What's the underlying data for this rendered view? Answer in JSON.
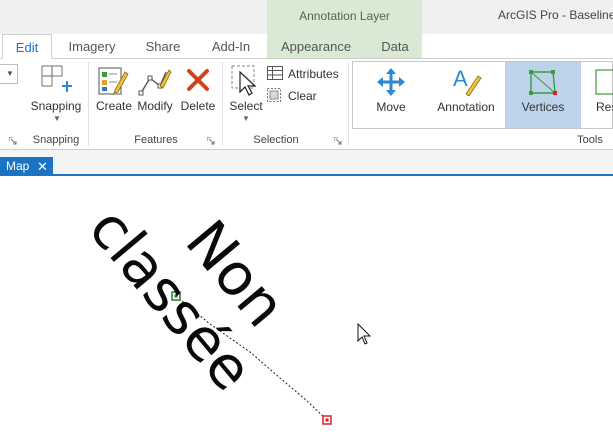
{
  "app": {
    "title": "ArcGIS Pro - BaselineA"
  },
  "context_tab_group": {
    "label": "Annotation Layer",
    "color": "#d9e9d3"
  },
  "tabs": [
    {
      "label": "Edit",
      "active": true
    },
    {
      "label": "Imagery"
    },
    {
      "label": "Share"
    },
    {
      "label": "Add-In"
    },
    {
      "label": "Appearance"
    },
    {
      "label": "Data"
    }
  ],
  "ribbon": {
    "snapping": {
      "button_label": "Snapping",
      "group_label": "Snapping"
    },
    "features": {
      "group_label": "Features",
      "create_label": "Create",
      "modify_label": "Modify",
      "delete_label": "Delete"
    },
    "selection": {
      "group_label": "Selection",
      "select_label": "Select",
      "attributes_label": "Attributes",
      "clear_label": "Clear"
    },
    "tools": {
      "group_label": "Tools",
      "move_label": "Move",
      "annotation_label": "Annotation",
      "vertices_label": "Vertices",
      "truncated_label": "Res"
    }
  },
  "map_tab": {
    "label": "Map",
    "close_icon": "close-icon"
  },
  "map": {
    "annotation_line1": "Non",
    "annotation_line2": "classée"
  },
  "colors": {
    "accent": "#1b73c4",
    "selected_tool": "#bcd3ea",
    "start_vertex": "#2b7a2b",
    "end_vertex": "#e02020",
    "delete_red": "#d0441c"
  }
}
